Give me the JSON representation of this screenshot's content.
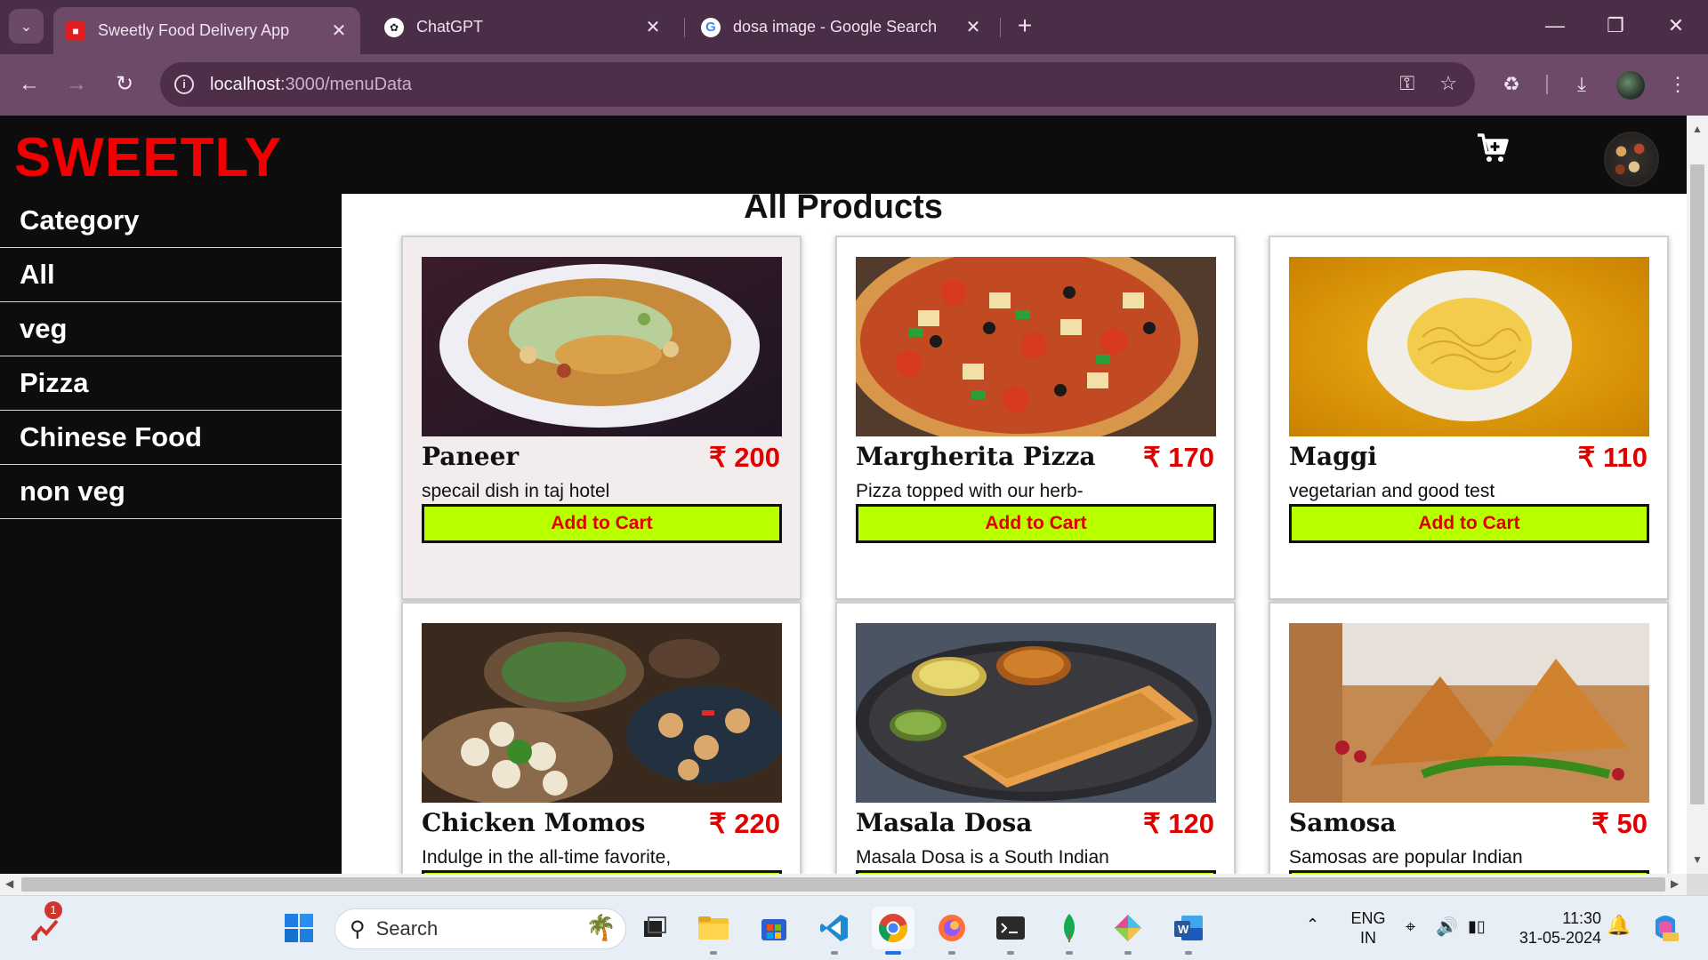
{
  "browser": {
    "tabs": [
      {
        "title": "Sweetly Food Delivery App",
        "active": true
      },
      {
        "title": "ChatGPT",
        "active": false
      },
      {
        "title": "dosa image - Google Search",
        "active": false
      }
    ],
    "url_host": "localhost",
    "url_path": ":3000/menuData"
  },
  "app": {
    "logo": "SWEETLY",
    "sidebar": {
      "items": [
        {
          "label": "Category"
        },
        {
          "label": "All"
        },
        {
          "label": "veg"
        },
        {
          "label": "Pizza"
        },
        {
          "label": "Chinese Food"
        },
        {
          "label": "non veg"
        }
      ]
    },
    "main": {
      "title": "All Products",
      "add_label": "Add to Cart",
      "products": [
        {
          "name": "Paneer",
          "price": "₹ 200",
          "desc": "specail dish in taj hotel"
        },
        {
          "name": "Margherita Pizza",
          "price": "₹ 170",
          "desc": "Pizza topped with our herb-"
        },
        {
          "name": "Maggi",
          "price": "₹ 110",
          "desc": "vegetarian and good test"
        },
        {
          "name": "Chicken Momos",
          "price": "₹ 220",
          "desc": "Indulge in the all-time favorite,"
        },
        {
          "name": "Masala Dosa",
          "price": "₹ 120",
          "desc": "Masala Dosa is a South Indian"
        },
        {
          "name": "Samosa",
          "price": "₹ 50",
          "desc": "Samosas are popular Indian"
        }
      ]
    }
  },
  "taskbar": {
    "search_label": "Search",
    "lang_line1": "ENG",
    "lang_line2": "IN",
    "time": "11:30",
    "date": "31-05-2024",
    "notification_count": "1"
  },
  "colors": {
    "brand_red": "#f00000",
    "add_button_bg": "#b8ff00",
    "price_red": "#e00000",
    "header_bg": "#0d0d0d"
  }
}
